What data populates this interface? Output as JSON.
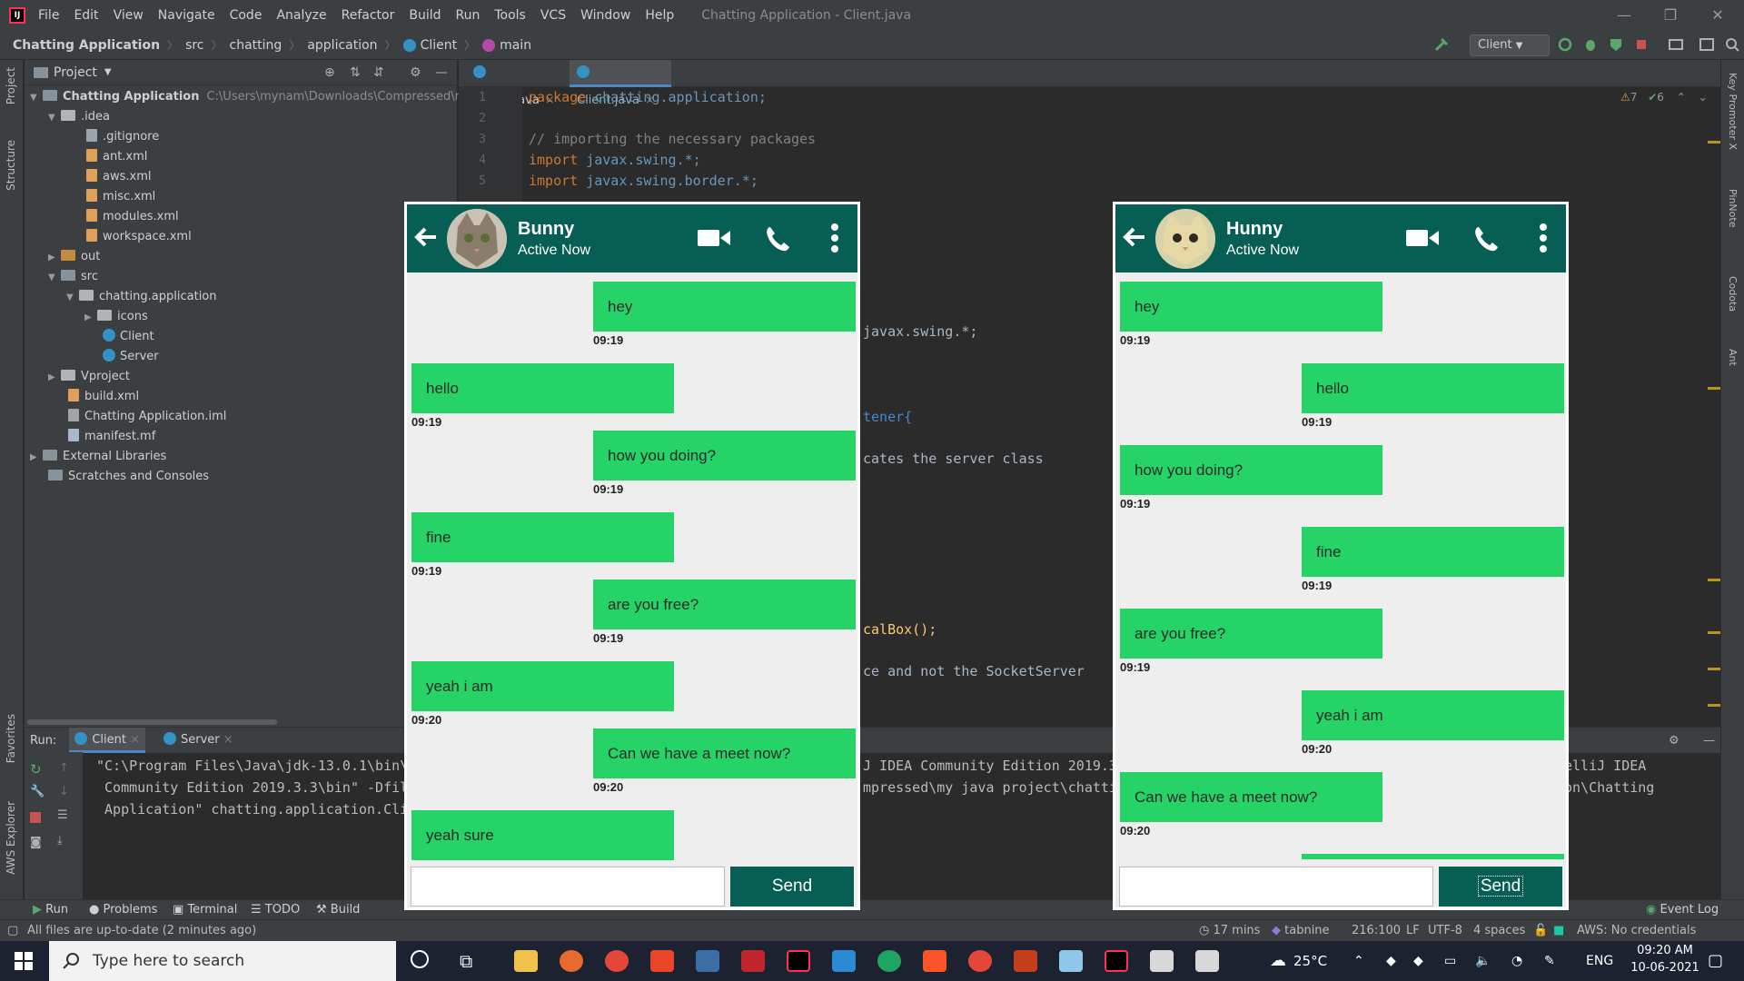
{
  "ide": {
    "menu": [
      "File",
      "Edit",
      "View",
      "Navigate",
      "Code",
      "Analyze",
      "Refactor",
      "Build",
      "Run",
      "Tools",
      "VCS",
      "Window",
      "Help"
    ],
    "window_title": "Chatting Application - Client.java",
    "breadcrumbs": [
      "Chatting Application",
      "src",
      "chatting",
      "application",
      "Client",
      "main"
    ],
    "run_config": "Client",
    "project_panel_title": "Project",
    "tree": {
      "root": "Chatting Application",
      "root_path": "C:\\Users\\mynam\\Downloads\\Compressed\\my java",
      "idea": ".idea",
      "gitignore": ".gitignore",
      "ant": "ant.xml",
      "aws": "aws.xml",
      "misc": "misc.xml",
      "modules": "modules.xml",
      "workspace": "workspace.xml",
      "out": "out",
      "src": "src",
      "pkg": "chatting.application",
      "icons": "icons",
      "client": "Client",
      "server": "Server",
      "vproject": "Vproject",
      "build": "build.xml",
      "iml": "Chatting Application.iml",
      "manifest": "manifest.mf",
      "ext": "External Libraries",
      "scratch": "Scratches and Consoles"
    },
    "tabs": [
      "Server.java",
      "Client.java"
    ],
    "line_numbers": [
      "1",
      "2",
      "3",
      "4",
      "5"
    ],
    "code": {
      "l1_kw": "package",
      "l1_rest": " chatting.application;",
      "l3": "// importing the necessary packages",
      "l4_kw": "import",
      "l4_rest": " javax.swing.*;",
      "l5_kw": "import",
      "l5_rest": " javax.swing.border.*;",
      "frag1": "javax.swing.*;",
      "frag2": "tener{",
      "frag3": "cates the server class",
      "frag4": "calBox();",
      "frag5": "ce and not the SocketServer"
    },
    "editor_badges": {
      "warnings": "7",
      "checks": "6"
    },
    "run": {
      "label": "Run:",
      "tabs": [
        "Client",
        "Server"
      ],
      "out_l1": "\"C:\\Program Files\\Java\\jdk-13.0.1\\bin\\",
      "out_l2": " Community Edition 2019.3.3\\bin\" -Dfil",
      "out_l3": " Application\" chatting.application.Cli",
      "out_m1": "J IDEA Community Edition 2019.3",
      "out_m2": "mpressed\\my java project\\chatti",
      "out_r1": "elliJ IDEA",
      "out_r2": "on\\Chatting"
    },
    "tool_windows": [
      "Run",
      "Problems",
      "Terminal",
      "TODO",
      "Build",
      "Event Log"
    ],
    "status": {
      "message": "All files are up-to-date (2 minutes ago)",
      "time_spent": "17 mins",
      "tabnine": "tabnine",
      "position": "216:100",
      "line_sep": "LF",
      "encoding": "UTF-8",
      "indent": "4 spaces",
      "aws": "AWS: No credentials selected"
    },
    "side_labels": {
      "project": "Project",
      "structure": "Structure",
      "favorites": "Favorites",
      "aws": "AWS Explorer",
      "key": "Key Promoter X",
      "pin": "PinNote",
      "codota": "Codota",
      "ant": "Ant"
    }
  },
  "taskbar": {
    "search_placeholder": "Type here to search",
    "weather": "25°C",
    "lang": "ENG",
    "time": "09:20 AM",
    "date": "10-06-2021"
  },
  "chat_left": {
    "name": "Bunny",
    "status": "Active Now",
    "send_label": "Send",
    "messages": [
      {
        "text": "hey",
        "time": "09:19",
        "side": "right"
      },
      {
        "text": "hello",
        "time": "09:19",
        "side": "left"
      },
      {
        "text": "how you doing?",
        "time": "09:19",
        "side": "right"
      },
      {
        "text": "fine",
        "time": "09:19",
        "side": "left"
      },
      {
        "text": "are you free?",
        "time": "09:19",
        "side": "right"
      },
      {
        "text": "yeah i am",
        "time": "09:20",
        "side": "left"
      },
      {
        "text": "Can we have a meet now?",
        "time": "09:20",
        "side": "right"
      },
      {
        "text": "yeah sure",
        "time": "",
        "side": "left"
      }
    ]
  },
  "chat_right": {
    "name": "Hunny",
    "status": "Active Now",
    "send_label": "Send",
    "messages": [
      {
        "text": "hey",
        "time": "09:19",
        "side": "left"
      },
      {
        "text": "hello",
        "time": "09:19",
        "side": "right"
      },
      {
        "text": "how you doing?",
        "time": "09:19",
        "side": "left"
      },
      {
        "text": "fine",
        "time": "09:19",
        "side": "right"
      },
      {
        "text": "are you free?",
        "time": "09:19",
        "side": "left"
      },
      {
        "text": "yeah i am",
        "time": "09:20",
        "side": "right"
      },
      {
        "text": "Can we have a meet now?",
        "time": "09:20",
        "side": "left"
      }
    ]
  },
  "colors": {
    "whatsapp_green": "#075e54",
    "bubble_green": "#25d366",
    "ide_bg": "#2b2b2b",
    "ide_panel": "#3c3f41"
  }
}
